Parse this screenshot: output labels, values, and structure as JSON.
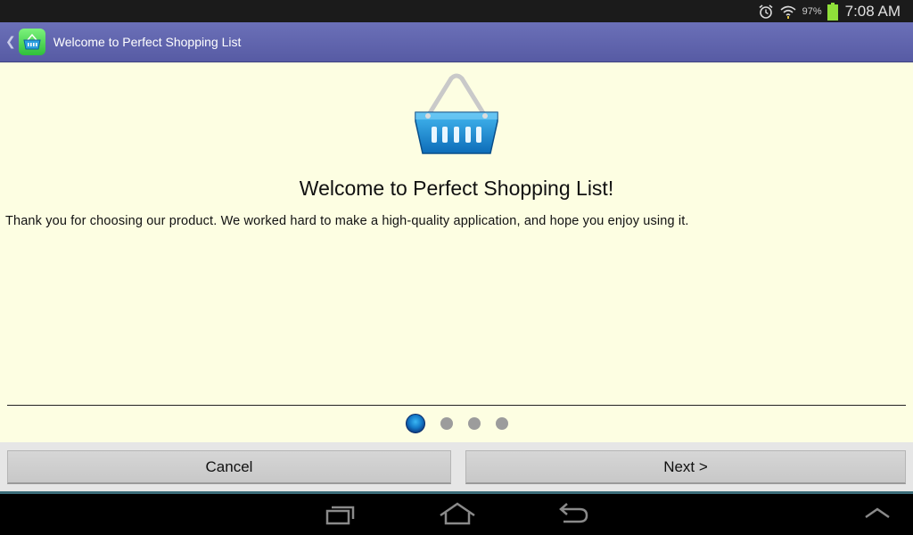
{
  "status_bar": {
    "battery_percent": "97%",
    "time": "7:08 AM",
    "icons": [
      "alarm-icon",
      "wifi-icon",
      "battery-icon"
    ]
  },
  "action_bar": {
    "title": "Welcome to Perfect Shopping List",
    "app_icon": "shopping-basket-icon"
  },
  "content": {
    "image": "shopping-basket-icon",
    "heading": "Welcome to Perfect Shopping List!",
    "body": "Thank you for choosing our product. We worked hard to make a high-quality application, and hope you enjoy using it."
  },
  "pager": {
    "total": 4,
    "current": 1
  },
  "buttons": {
    "cancel": "Cancel",
    "next": "Next >"
  },
  "nav_bar": {
    "icons": [
      "recent-apps-icon",
      "home-icon",
      "back-icon",
      "menu-up-icon"
    ]
  },
  "colors": {
    "action_bar": "#5f63ad",
    "content_bg": "#fdfee2",
    "active_dot": "#1479c8",
    "inactive_dot": "#9c9c9c"
  }
}
